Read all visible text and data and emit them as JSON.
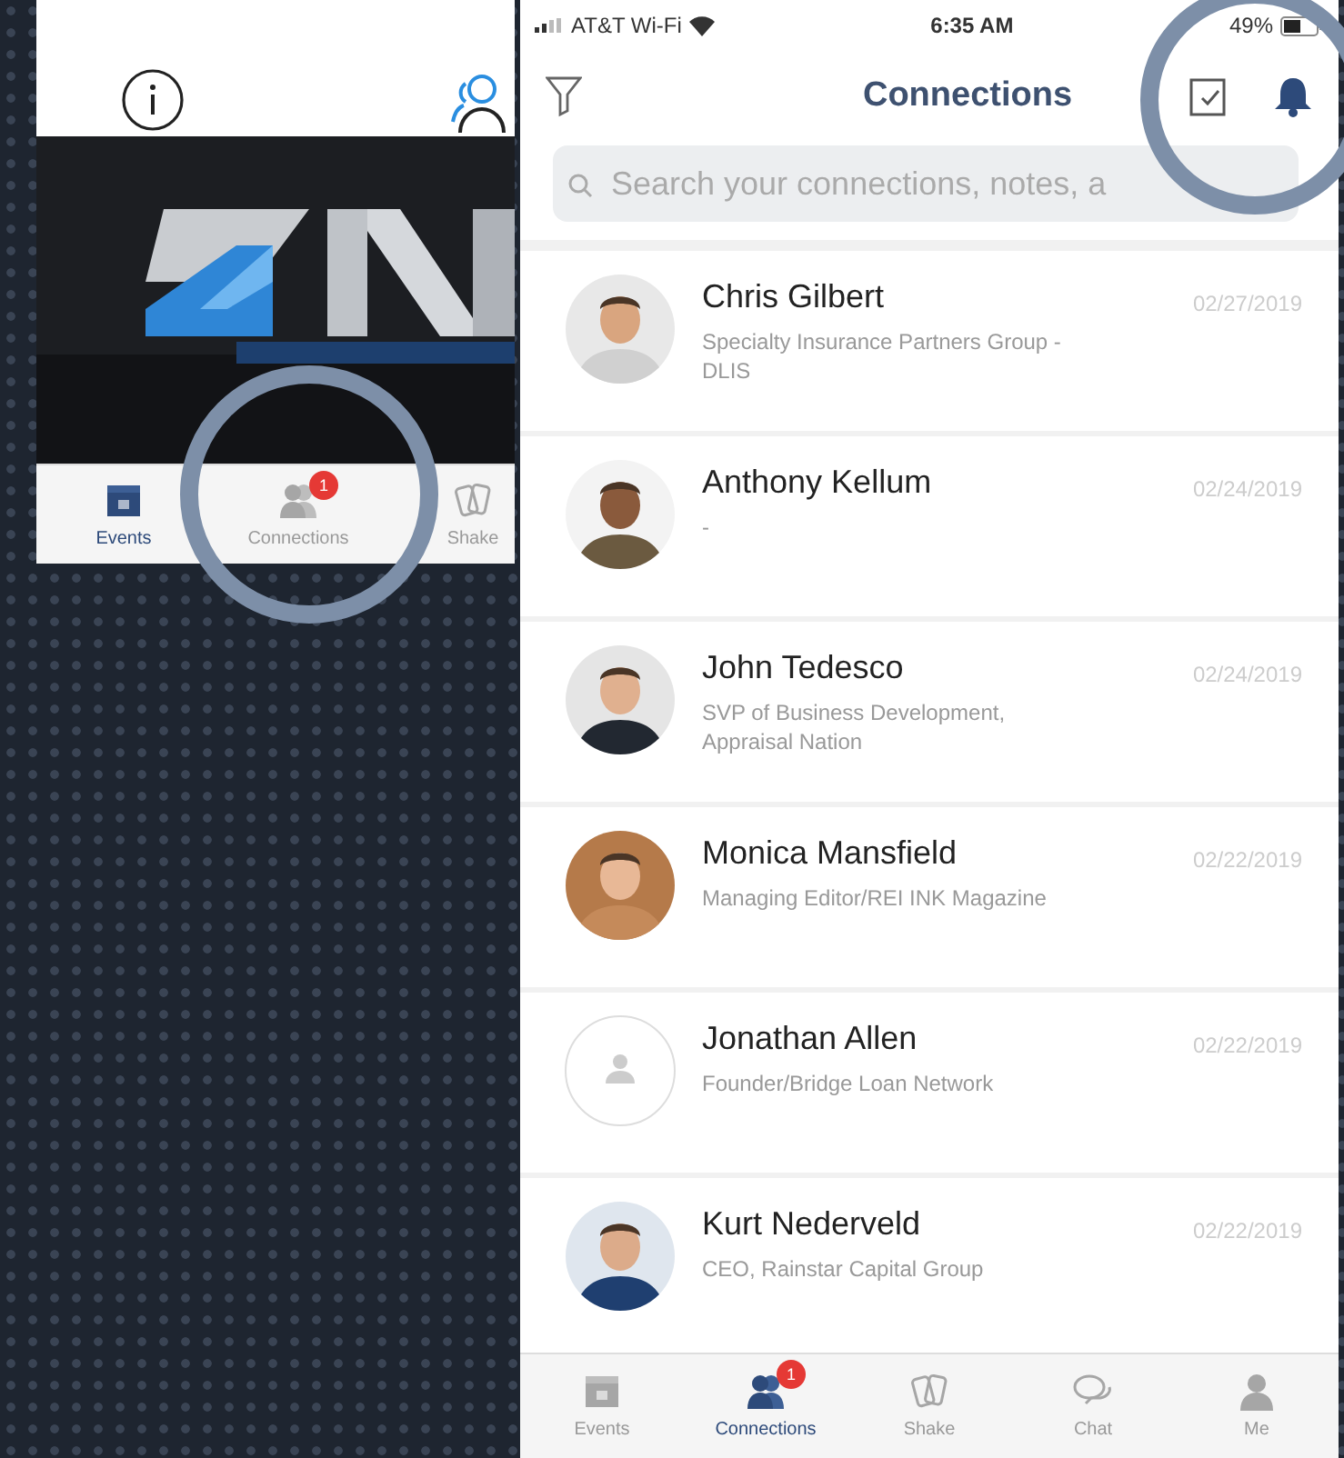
{
  "left_screen": {
    "tab_bar": [
      {
        "label": "Events",
        "selected": true
      },
      {
        "label": "Connections",
        "selected": false,
        "badge": "1"
      },
      {
        "label": "Shake",
        "selected": false
      }
    ]
  },
  "right_screen": {
    "status_bar": {
      "carrier": "AT&T Wi-Fi",
      "time": "6:35 AM",
      "battery": "49%"
    },
    "title": "Connections",
    "search": {
      "placeholder": "Search your connections, notes, a"
    },
    "connections": [
      {
        "name": "Chris Gilbert",
        "subtitle": "Specialty Insurance Partners Group - DLIS",
        "date": "02/27/2019"
      },
      {
        "name": "Anthony Kellum",
        "subtitle": "-",
        "date": "02/24/2019"
      },
      {
        "name": "John Tedesco",
        "subtitle": "SVP of Business Development, Appraisal Nation",
        "date": "02/24/2019"
      },
      {
        "name": "Monica Mansfield",
        "subtitle": "Managing Editor/REI INK Magazine",
        "date": "02/22/2019"
      },
      {
        "name": "Jonathan Allen",
        "subtitle": "Founder/Bridge Loan Network",
        "date": "02/22/2019",
        "kind": "placeholder"
      },
      {
        "name": "Kurt Nederveld",
        "subtitle": "CEO, Rainstar Capital Group",
        "date": "02/22/2019"
      }
    ],
    "tab_bar": [
      {
        "label": "Events",
        "selected": false
      },
      {
        "label": "Connections",
        "selected": true,
        "badge": "1"
      },
      {
        "label": "Shake",
        "selected": false
      },
      {
        "label": "Chat",
        "selected": false
      },
      {
        "label": "Me",
        "selected": false
      }
    ]
  }
}
